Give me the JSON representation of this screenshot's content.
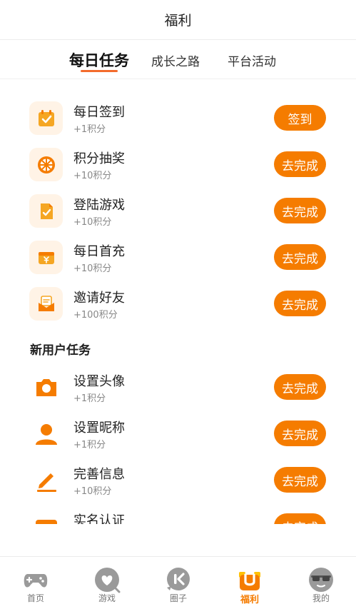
{
  "header": {
    "title": "福利"
  },
  "tabs": [
    {
      "label": "每日任务",
      "active": true
    },
    {
      "label": "成长之路",
      "active": false
    },
    {
      "label": "平台活动",
      "active": false
    }
  ],
  "daily_tasks": [
    {
      "name": "每日签到",
      "reward": "+1积分",
      "button": "签到",
      "icon": "calendar-check-icon"
    },
    {
      "name": "积分抽奖",
      "reward": "+10积分",
      "button": "去完成",
      "icon": "lottery-wheel-icon"
    },
    {
      "name": "登陆游戏",
      "reward": "+10积分",
      "button": "去完成",
      "icon": "document-check-icon"
    },
    {
      "name": "每日首充",
      "reward": "+10积分",
      "button": "去完成",
      "icon": "wallet-yen-icon"
    },
    {
      "name": "邀请好友",
      "reward": "+100积分",
      "button": "去完成",
      "icon": "envelope-icon"
    }
  ],
  "new_user_section": {
    "title": "新用户任务"
  },
  "new_user_tasks": [
    {
      "name": "设置头像",
      "reward": "+1积分",
      "button": "去完成",
      "icon": "camera-icon"
    },
    {
      "name": "设置昵称",
      "reward": "+1积分",
      "button": "去完成",
      "icon": "person-icon"
    },
    {
      "name": "完善信息",
      "reward": "+10积分",
      "button": "去完成",
      "icon": "pencil-icon"
    },
    {
      "name": "实名认证",
      "reward": "",
      "button": "去完成",
      "icon": "id-card-icon"
    }
  ],
  "bottom_nav": [
    {
      "label": "首页",
      "icon": "gamepad-icon",
      "active": false
    },
    {
      "label": "游戏",
      "icon": "heart-bubble-icon",
      "active": false
    },
    {
      "label": "圈子",
      "icon": "circle-chat-icon",
      "active": false
    },
    {
      "label": "福利",
      "icon": "gift-icon",
      "active": true
    },
    {
      "label": "我的",
      "icon": "sunglasses-face-icon",
      "active": false
    }
  ],
  "colors": {
    "accent": "#f57c00",
    "tab_underline": "#f36b2c",
    "icon_tile_bg": "#fff3e6"
  }
}
